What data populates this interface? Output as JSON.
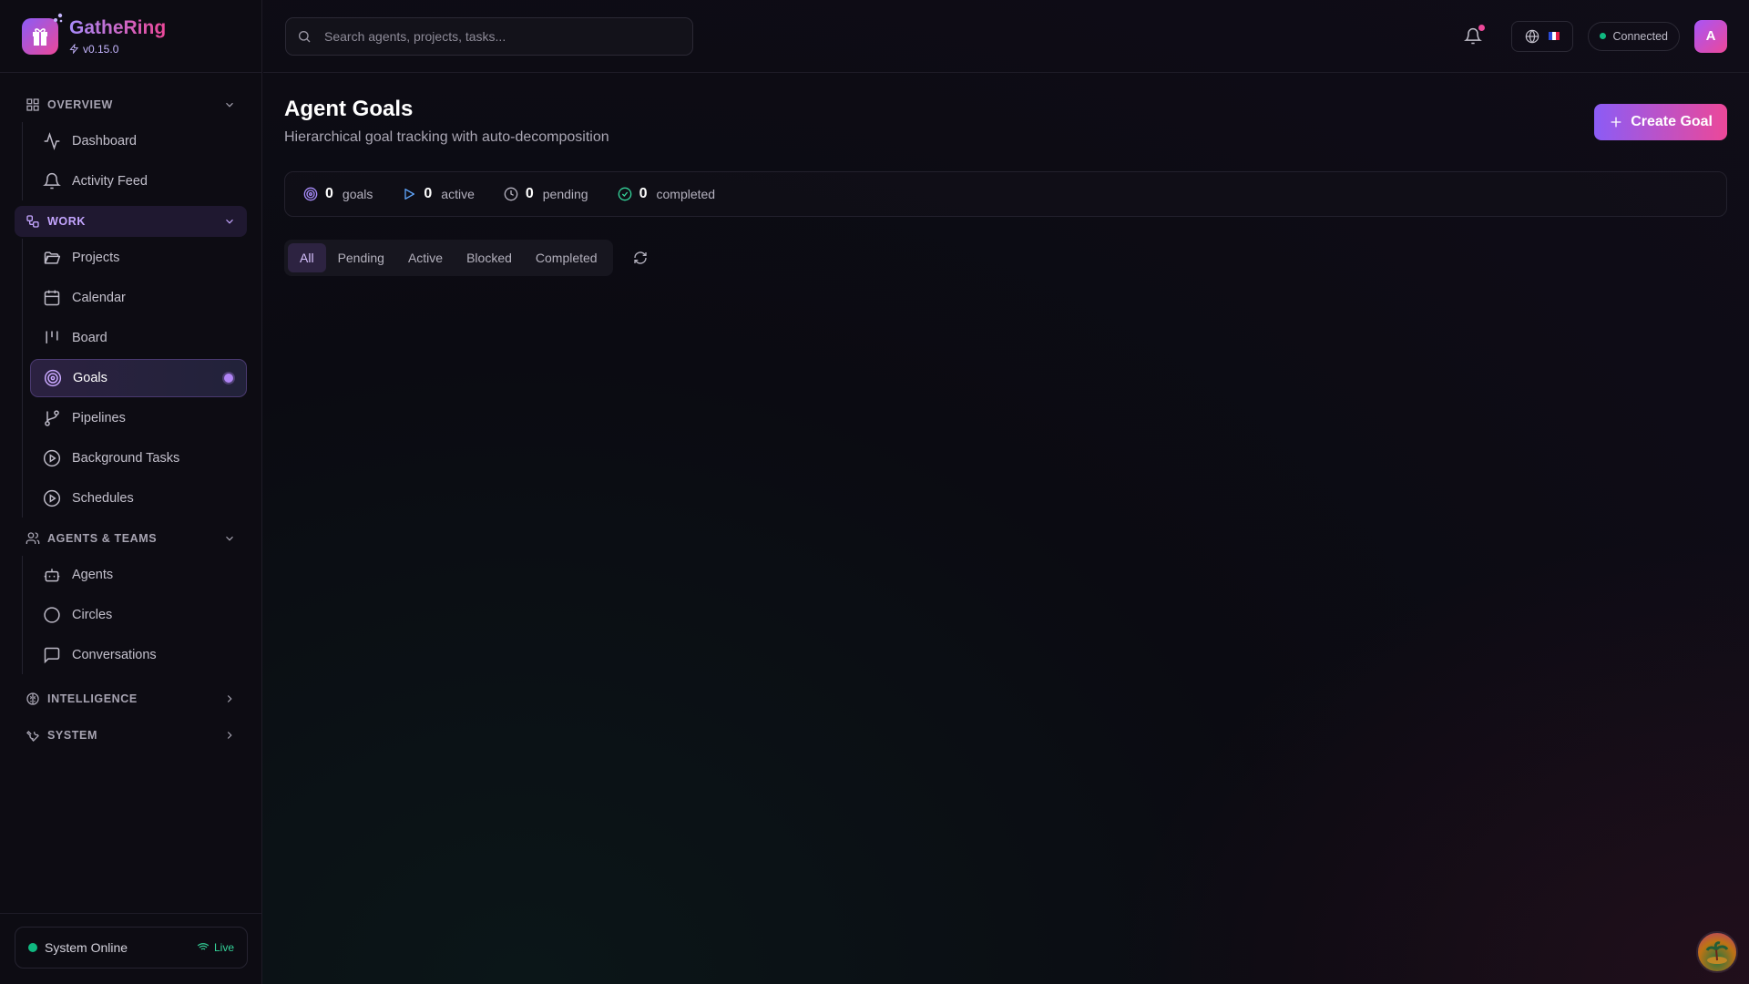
{
  "app": {
    "name": "GatheRing",
    "version": "v0.15.0"
  },
  "sidebar": {
    "sections": [
      {
        "label": "OVERVIEW",
        "items": [
          {
            "label": "Dashboard"
          },
          {
            "label": "Activity Feed"
          }
        ]
      },
      {
        "label": "WORK",
        "items": [
          {
            "label": "Projects"
          },
          {
            "label": "Calendar"
          },
          {
            "label": "Board"
          },
          {
            "label": "Goals"
          },
          {
            "label": "Pipelines"
          },
          {
            "label": "Background Tasks"
          },
          {
            "label": "Schedules"
          }
        ]
      },
      {
        "label": "AGENTS & TEAMS",
        "items": [
          {
            "label": "Agents"
          },
          {
            "label": "Circles"
          },
          {
            "label": "Conversations"
          }
        ]
      },
      {
        "label": "INTELLIGENCE"
      },
      {
        "label": "SYSTEM"
      }
    ],
    "status": {
      "label": "System Online",
      "live": "Live"
    }
  },
  "topbar": {
    "search_placeholder": "Search agents, projects, tasks...",
    "connection": "Connected",
    "avatar_initial": "A"
  },
  "page": {
    "title": "Agent Goals",
    "subtitle": "Hierarchical goal tracking with auto-decomposition",
    "create_label": "Create Goal",
    "stats": [
      {
        "value": "0",
        "label": "goals"
      },
      {
        "value": "0",
        "label": "active"
      },
      {
        "value": "0",
        "label": "pending"
      },
      {
        "value": "0",
        "label": "completed"
      }
    ],
    "filters": [
      "All",
      "Pending",
      "Active",
      "Blocked",
      "Completed"
    ]
  },
  "colors": {
    "accent": "#8b5cf6",
    "accent2": "#ec4899",
    "online": "#10b981"
  }
}
